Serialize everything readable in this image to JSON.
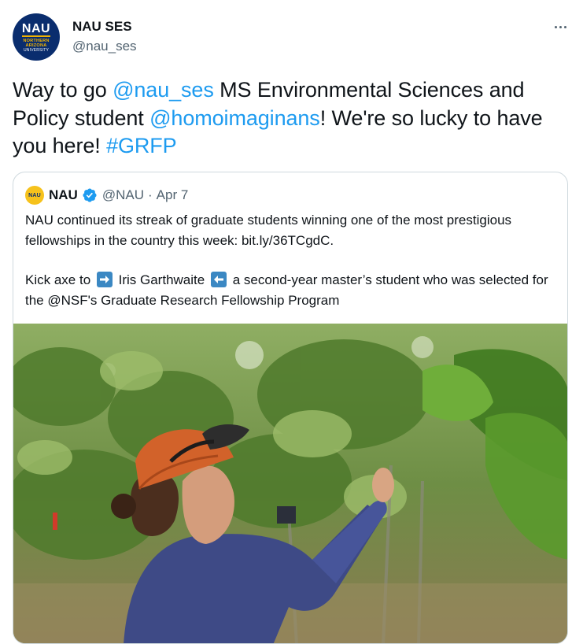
{
  "tweet": {
    "author": {
      "name": "NAU SES",
      "handle": "@nau_ses",
      "avatar_logo": "NAU",
      "avatar_subtext": [
        "NORTHERN",
        "ARIZONA",
        "UNIVERSITY"
      ]
    },
    "more_icon": "more-horizontal-icon",
    "text_segments": [
      {
        "type": "text",
        "value": "Way to go "
      },
      {
        "type": "mention",
        "value": "@nau_ses"
      },
      {
        "type": "text",
        "value": " MS Environmental Sciences and Policy student "
      },
      {
        "type": "mention",
        "value": "@homoimaginans"
      },
      {
        "type": "text",
        "value": "! We're so lucky to have you here! "
      },
      {
        "type": "hashtag",
        "value": "#GRFP"
      }
    ],
    "quote": {
      "avatar_logo": "NAU",
      "name": "NAU",
      "verified": true,
      "handle": "@NAU",
      "dot": "·",
      "date": "Apr 7",
      "paragraph1": "NAU continued its streak of graduate students winning one of the most prestigious fellowships in the country this week: bit.ly/36TCgdC.",
      "paragraph2": {
        "before": "Kick axe to",
        "emoji_right": "right-arrow-emoji",
        "middle": "Iris Garthwaite",
        "emoji_left": "left-arrow-emoji",
        "after": "a second-year master’s student who was selected for the @NSF's Graduate Research Fellowship Program"
      },
      "photo_alt": "student-examining-leaves-photo"
    }
  },
  "colors": {
    "link": "#1d9bf0",
    "text": "#0f1419",
    "secondary": "#536471",
    "border": "#cfd9de",
    "nau_blue": "#0a2d6e",
    "nau_gold": "#f2b300"
  }
}
